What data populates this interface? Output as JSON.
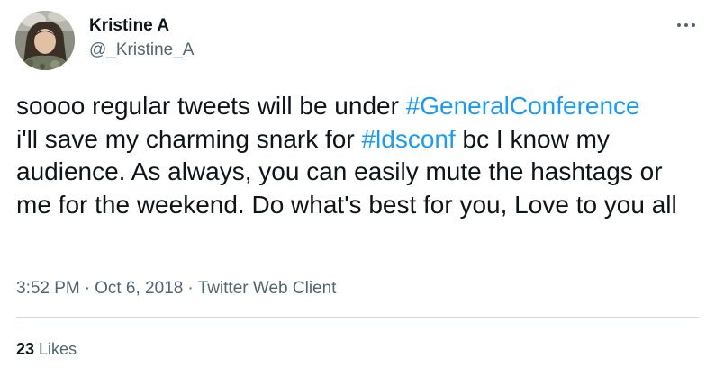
{
  "author": {
    "display_name": "Kristine A",
    "handle": "@_Kristine_A"
  },
  "tweet": {
    "segments": [
      {
        "text": "soooo regular tweets will be under ",
        "type": "text"
      },
      {
        "text": "#GeneralConference",
        "type": "hashtag"
      },
      {
        "text": " i'll save my charming snark for ",
        "type": "text"
      },
      {
        "text": "#ldsconf",
        "type": "hashtag"
      },
      {
        "text": " bc I know my audience. As always, you can easily mute the hashtags or me for the weekend. Do what's best for you, Love to you all",
        "type": "text"
      }
    ]
  },
  "meta": {
    "time": "3:52 PM",
    "separator": "·",
    "date": "Oct 6, 2018",
    "client": "Twitter Web Client"
  },
  "stats": {
    "likes_count": "23",
    "likes_label": "Likes"
  },
  "icons": {
    "more": "more-horizontal-icon"
  },
  "colors": {
    "hashtag": "#1d9bf0",
    "secondary_text": "#536471",
    "primary_text": "#0f1419",
    "divider": "#cfd9de"
  }
}
